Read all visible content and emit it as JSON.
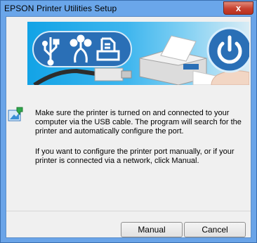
{
  "window": {
    "title": "EPSON Printer Utilities Setup",
    "close_label": "x"
  },
  "banner": {
    "icons": [
      "usb-icon",
      "firewire-icon",
      "printer-icon",
      "power-icon"
    ]
  },
  "message": {
    "paragraph1": "Make sure the printer is turned on and connected to your computer via the USB cable. The program will search for the printer and automatically configure the port.",
    "paragraph2": "If you want to configure the printer port manually, or if your printer is connected via a network, click Manual."
  },
  "buttons": {
    "manual": "Manual",
    "cancel": "Cancel"
  },
  "colors": {
    "titlebar": "#6aa6ea",
    "close": "#c7402f",
    "banner_blue": "#12a3e6",
    "icon_blue": "#2a6fb6"
  }
}
